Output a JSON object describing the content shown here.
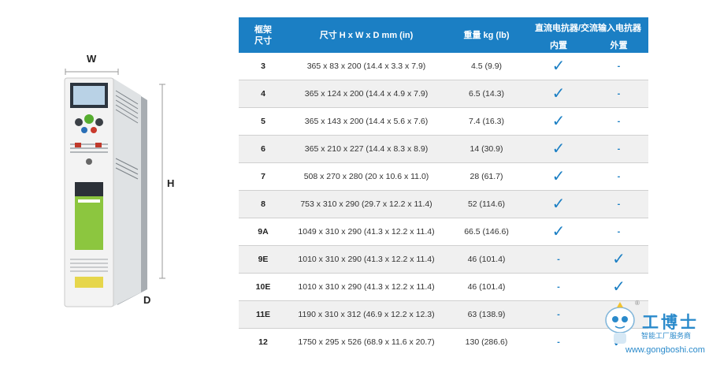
{
  "figure": {
    "labels": {
      "w": "W",
      "h": "H",
      "d": "D"
    }
  },
  "table": {
    "headers": {
      "frame": "框架\n尺寸",
      "dims": "尺寸 H x W x D mm (in)",
      "weight": "重量 kg (lb)",
      "choke_group": "直流电抗器/交流输入电抗器",
      "internal": "内置",
      "external": "外置"
    },
    "rows": [
      {
        "frame": "3",
        "dims": "365 x 83 x 200 (14.4 x 3.3 x 7.9)",
        "weight": "4.5 (9.9)",
        "internal": "check",
        "external": "dash"
      },
      {
        "frame": "4",
        "dims": "365 x 124 x 200 (14.4 x 4.9 x 7.9)",
        "weight": "6.5 (14.3)",
        "internal": "check",
        "external": "dash"
      },
      {
        "frame": "5",
        "dims": "365 x 143 x 200 (14.4 x 5.6 x 7.6)",
        "weight": "7.4 (16.3)",
        "internal": "check",
        "external": "dash"
      },
      {
        "frame": "6",
        "dims": "365 x 210 x 227 (14.4 x 8.3 x 8.9)",
        "weight": "14 (30.9)",
        "internal": "check",
        "external": "dash"
      },
      {
        "frame": "7",
        "dims": "508 x 270 x 280 (20 x 10.6 x 11.0)",
        "weight": "28 (61.7)",
        "internal": "check",
        "external": "dash"
      },
      {
        "frame": "8",
        "dims": "753 x 310 x 290 (29.7 x 12.2 x 11.4)",
        "weight": "52 (114.6)",
        "internal": "check",
        "external": "dash"
      },
      {
        "frame": "9A",
        "dims": "1049 x 310 x 290 (41.3 x 12.2 x 11.4)",
        "weight": "66.5 (146.6)",
        "internal": "check",
        "external": "dash"
      },
      {
        "frame": "9E",
        "dims": "1010 x 310 x 290 (41.3 x 12.2 x 11.4)",
        "weight": "46 (101.4)",
        "internal": "dash",
        "external": "check"
      },
      {
        "frame": "10E",
        "dims": "1010 x 310 x 290 (41.3 x 12.2 x 11.4)",
        "weight": "46 (101.4)",
        "internal": "dash",
        "external": "check"
      },
      {
        "frame": "11E",
        "dims": "1190 x 310 x 312 (46.9 x 12.2 x 12.3)",
        "weight": "63 (138.9)",
        "internal": "dash",
        "external": "check"
      },
      {
        "frame": "12",
        "dims": "1750 x 295 x 526 (68.9 x 11.6 x 20.7)",
        "weight": "130 (286.6)",
        "internal": "dash",
        "external": "check"
      }
    ],
    "symbols": {
      "check": "✓",
      "dash": "-"
    },
    "accent_color": "#1b7fc4"
  },
  "watermark": {
    "title": "工博士",
    "subtitle": "智能工厂服务商",
    "url": "www.gongboshi.com",
    "registered": "®"
  }
}
